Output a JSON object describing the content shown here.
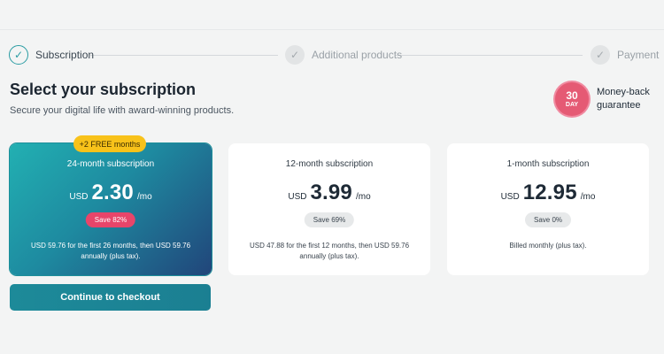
{
  "stepper": {
    "steps": [
      {
        "label": "Subscription",
        "state": "active",
        "icon": "check-icon"
      },
      {
        "label": "Additional products",
        "state": "inactive",
        "icon": "check-icon"
      },
      {
        "label": "Payment",
        "state": "inactive",
        "icon": "check-icon"
      }
    ]
  },
  "header": {
    "title": "Select your subscription",
    "subtitle": "Secure your digital life with award-winning products."
  },
  "guarantee": {
    "badge_number": "30",
    "badge_unit": "DAY",
    "text": "Money-back guarantee"
  },
  "plans": [
    {
      "tag": "+2 FREE months",
      "name": "24-month subscription",
      "currency": "USD",
      "amount": "2.30",
      "period": "/mo",
      "save": "Save 82%",
      "billing": "USD 59.76 for the first 26 months, then USD 59.76 annually (plus tax).",
      "selected": true
    },
    {
      "name": "12-month subscription",
      "currency": "USD",
      "amount": "3.99",
      "period": "/mo",
      "save": "Save 69%",
      "billing": "USD 47.88 for the first 12 months, then USD 59.76 annually (plus tax).",
      "selected": false
    },
    {
      "name": "1-month subscription",
      "currency": "USD",
      "amount": "12.95",
      "period": "/mo",
      "save": "Save 0%",
      "billing": "Billed monthly (plus tax).",
      "selected": false
    }
  ],
  "checkout": {
    "label": "Continue to checkout"
  },
  "colors": {
    "accent": "#1d8a99",
    "save_highlight": "#e8456a",
    "tag": "#f8c21a",
    "badge": "#e55a74"
  }
}
